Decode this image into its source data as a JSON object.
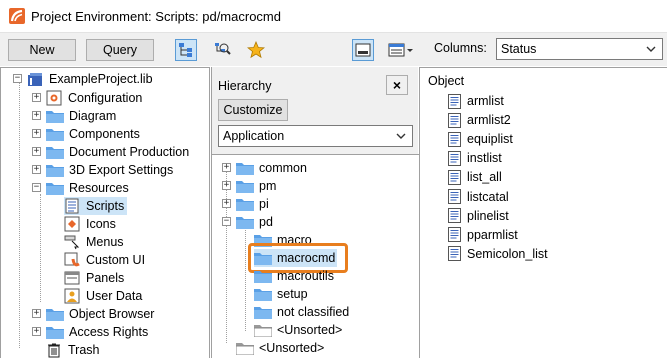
{
  "window": {
    "title": "Project Environment: Scripts: pd/macrocmd"
  },
  "toolbar": {
    "new_label": "New",
    "query_label": "Query",
    "columns_label": "Columns:",
    "columns_value": "Status"
  },
  "left_tree": {
    "root": "ExampleProject.lib",
    "items": [
      {
        "label": "Configuration"
      },
      {
        "label": "Diagram"
      },
      {
        "label": "Components"
      },
      {
        "label": "Document Production"
      },
      {
        "label": "3D Export Settings"
      },
      {
        "label": "Resources"
      },
      {
        "label": "Scripts"
      },
      {
        "label": "Icons"
      },
      {
        "label": "Menus"
      },
      {
        "label": "Custom UI"
      },
      {
        "label": "Panels"
      },
      {
        "label": "User Data"
      },
      {
        "label": "Object Browser"
      },
      {
        "label": "Access Rights"
      },
      {
        "label": "Trash"
      }
    ]
  },
  "hierarchy": {
    "label": "Hierarchy",
    "close_label": "×",
    "customize_label": "Customize",
    "dropdown_value": "Application",
    "items": [
      {
        "label": "common"
      },
      {
        "label": "pm"
      },
      {
        "label": "pi"
      },
      {
        "label": "pd"
      },
      {
        "label": "macro"
      },
      {
        "label": "macrocmd"
      },
      {
        "label": "macroutils"
      },
      {
        "label": "setup"
      },
      {
        "label": "not classified"
      },
      {
        "label": "<Unsorted>"
      },
      {
        "label": "<Unsorted>"
      }
    ]
  },
  "objects": {
    "header": "Object",
    "items": [
      "armlist",
      "armlist2",
      "equiplist",
      "instlist",
      "list_all",
      "listcatal",
      "plinelist",
      "pparmlist",
      "Semicolon_list"
    ]
  },
  "colors": {
    "highlight": "#e87e1e",
    "folder": "#5aa0e6",
    "selected": "#cce4f7"
  }
}
